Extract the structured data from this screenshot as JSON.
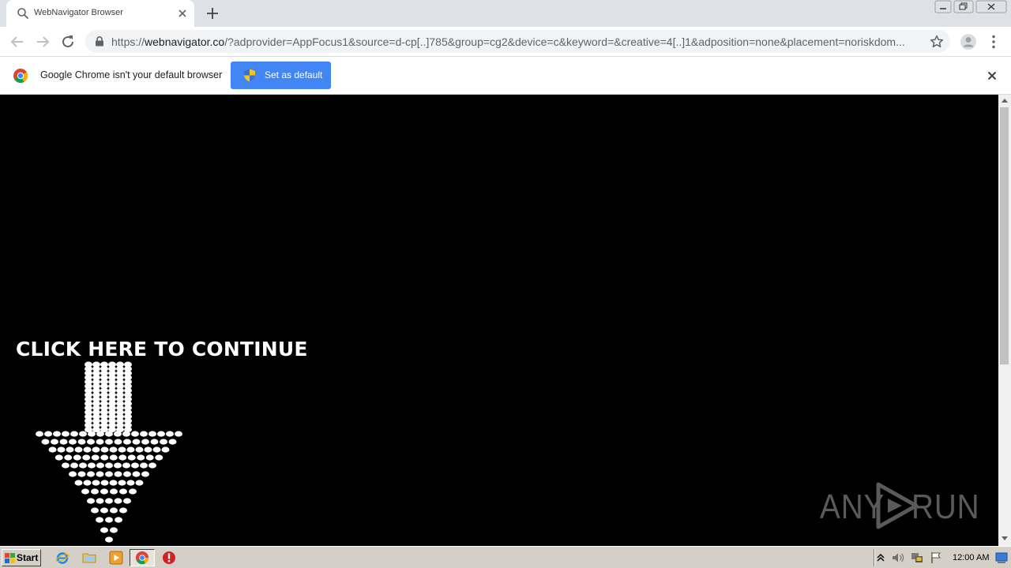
{
  "window": {
    "tab_title": "WebNavigator Browser"
  },
  "toolbar": {
    "url_scheme": "https://",
    "url_host": "webnavigator.co",
    "url_rest": "/?adprovider=AppFocus1&source=d-cp[..]785&group=cg2&device=c&keyword=&creative=4[..]1&adposition=none&placement=noriskdom..."
  },
  "infobar": {
    "message": "Google Chrome isn't your default browser",
    "button_label": "Set as default"
  },
  "page": {
    "cta_text": "CLICK HERE TO CONTINUE",
    "watermark_left": "ANY",
    "watermark_right": "RUN"
  },
  "taskbar": {
    "start_label": "Start",
    "clock": "12:00 AM"
  },
  "colors": {
    "infobar_button": "#4285f4",
    "page_background": "#000000",
    "taskbar": "#d4d0c8"
  },
  "icons": [
    "search-icon",
    "close-icon",
    "plus-icon",
    "back-icon",
    "forward-icon",
    "reload-icon",
    "lock-icon",
    "star-icon",
    "profile-icon",
    "menu-icon",
    "chrome-logo-icon",
    "shield-icon",
    "windows-flag-icon",
    "ie-icon",
    "folder-icon",
    "media-player-icon",
    "chrome-icon",
    "stop-icon"
  ]
}
